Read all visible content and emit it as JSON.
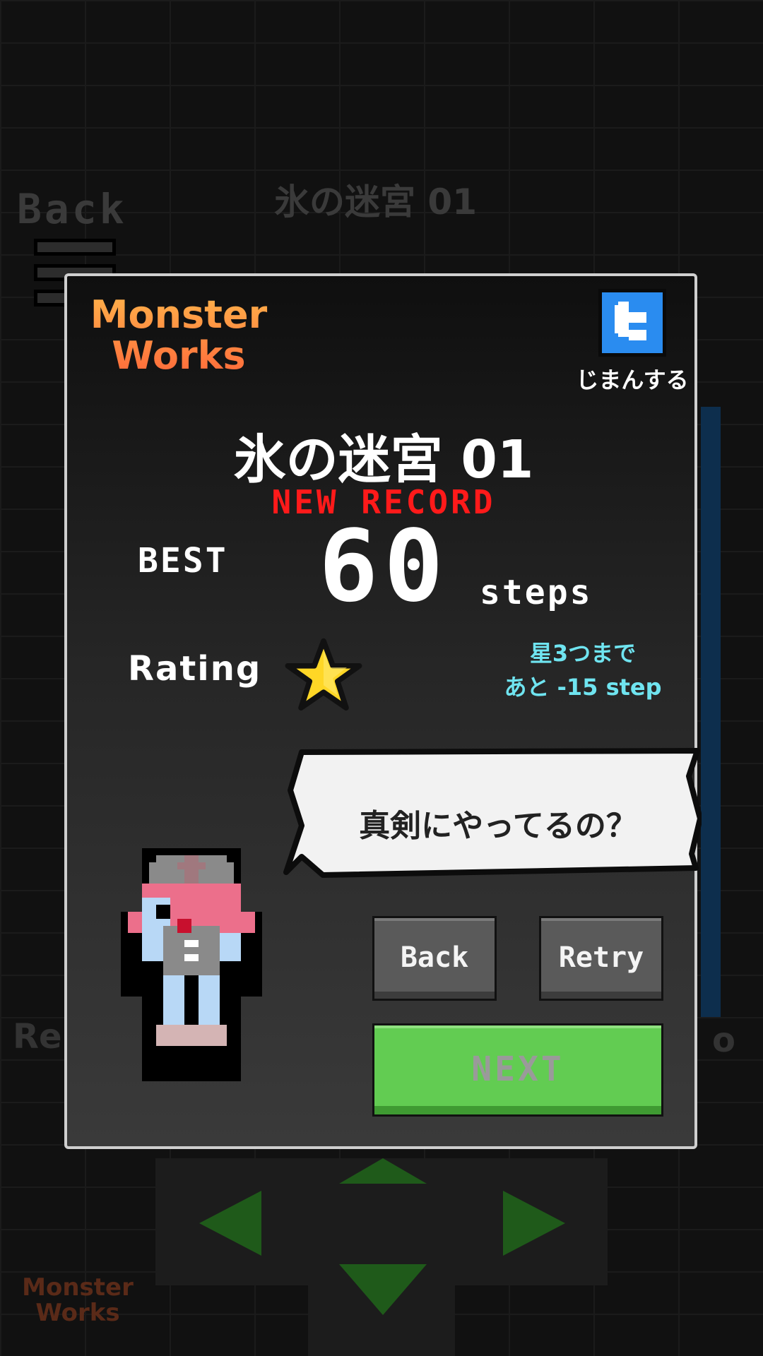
{
  "background": {
    "back_label": "Back",
    "stage_title": "氷の迷宮 01",
    "left_label": "Re",
    "right_label": "o",
    "logo_line1": "Monster",
    "logo_line2": "Works"
  },
  "dialog": {
    "logo": {
      "line1": "Monster",
      "line2": "Works"
    },
    "share": {
      "icon": "twitter-icon",
      "label": "じまんする",
      "color": "#2a8cf0"
    },
    "stage_title": "氷の迷宮 01",
    "new_record": "NEW RECORD",
    "best_label": "BEST",
    "best_value": "60",
    "steps_label": "steps",
    "rating_label": "Rating",
    "rating_stars": 1,
    "hint_line1": "星3つまで",
    "hint_line2": "あと -15 step",
    "speech": "真剣にやってるの？",
    "buttons": {
      "back": "Back",
      "retry": "Retry",
      "next": "NEXT"
    }
  },
  "colors": {
    "new_record": "#ff1a1a",
    "hint": "#6fe4f0",
    "next_button": "#62cc52",
    "gray_button": "#5a5a5a"
  }
}
